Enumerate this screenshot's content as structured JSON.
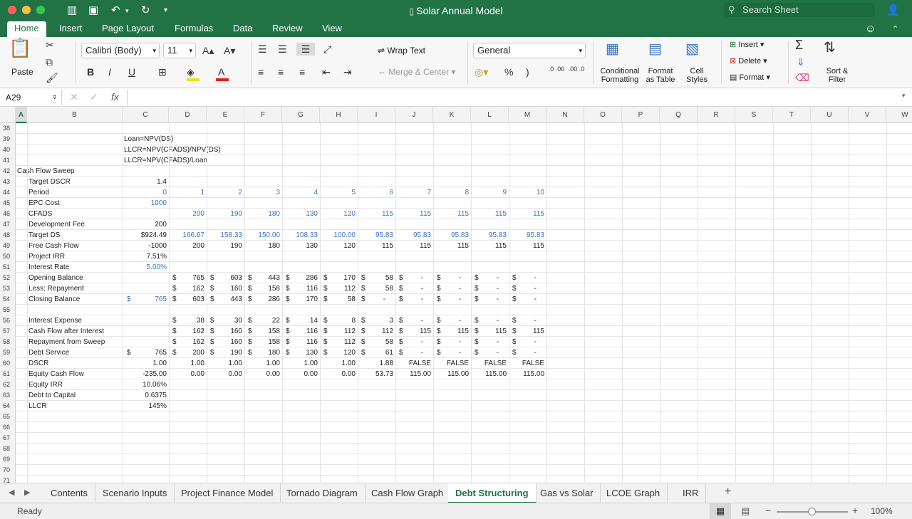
{
  "window": {
    "title": "Solar Annual Model",
    "search_placeholder": "Search Sheet"
  },
  "ribbon_tabs": [
    "Home",
    "Insert",
    "Page Layout",
    "Formulas",
    "Data",
    "Review",
    "View"
  ],
  "ribbon": {
    "paste": "Paste",
    "font_name": "Calibri (Body)",
    "font_size": "11",
    "wrap_text": "Wrap Text",
    "merge_center": "Merge & Center",
    "number_format": "General",
    "percent": "%",
    "comma": ")",
    "dec_inc": ".0 .00",
    "dec_dec": ".00 .0",
    "conditional": "Conditional",
    "formatting": "Formatting",
    "format": "Format",
    "as_table": "as Table",
    "cell": "Cell",
    "styles": "Styles",
    "insert": "Insert",
    "delete": "Delete",
    "format_menu": "Format",
    "sort": "Sort &",
    "filter": "Filter",
    "bold": "B",
    "italic": "I",
    "underline": "U",
    "font_a": "A"
  },
  "formula_bar": {
    "cell_ref": "A29",
    "fx": "fx",
    "value": ""
  },
  "columns": [
    "A",
    "B",
    "C",
    "D",
    "E",
    "F",
    "G",
    "H",
    "I",
    "J",
    "K",
    "L",
    "M",
    "N",
    "O",
    "P",
    "Q",
    "R",
    "S",
    "T",
    "U",
    "V",
    "W"
  ],
  "rows": [
    {
      "n": "38",
      "label": "",
      "sub": false,
      "c": "",
      "cb": false,
      "cells": [],
      "dollar": false
    },
    {
      "n": "39",
      "label": "",
      "sub": false,
      "c": "Loan=NPV(DS)",
      "cl": true,
      "cells": [],
      "dollar": false
    },
    {
      "n": "40",
      "label": "",
      "sub": false,
      "c": "LLCR=NPV(CFADS)/NPV(DS)",
      "cl": true,
      "cells": [],
      "dollar": false
    },
    {
      "n": "41",
      "label": "",
      "sub": false,
      "c": "LLCR=NPV(CFADS)/Loan",
      "cl": true,
      "cells": [],
      "dollar": false
    },
    {
      "n": "42",
      "label": "Cash Flow Sweep",
      "sub": false,
      "c": "",
      "cells": [],
      "dollar": false
    },
    {
      "n": "43",
      "label": "Target DSCR",
      "sub": true,
      "c": "1.4",
      "cells": [],
      "dollar": false
    },
    {
      "n": "44",
      "label": "Period",
      "sub": true,
      "c": "0",
      "cb": true,
      "cells": [
        "1",
        "2",
        "3",
        "4",
        "5",
        "6",
        "7",
        "8",
        "9",
        "10"
      ],
      "blue": true,
      "dollar": false
    },
    {
      "n": "45",
      "label": "EPC Cost",
      "sub": true,
      "c": "1000",
      "cb": true,
      "cells": [],
      "dollar": false
    },
    {
      "n": "46",
      "label": "CFADS",
      "sub": true,
      "c": "",
      "cells": [
        "200",
        "190",
        "180",
        "130",
        "120",
        "115",
        "115",
        "115",
        "115",
        "115"
      ],
      "blue": true,
      "dollar": false
    },
    {
      "n": "47",
      "label": "Development Fee",
      "sub": true,
      "c": "200",
      "cells": [],
      "dollar": false
    },
    {
      "n": "48",
      "label": "Target DS",
      "sub": true,
      "c": "$924.49",
      "cells": [
        "166.67",
        "158.33",
        "150.00",
        "108.33",
        "100.00",
        "95.83",
        "95.83",
        "95.83",
        "95.83",
        "95.83"
      ],
      "blue": true,
      "dollar": false
    },
    {
      "n": "49",
      "label": "Free Cash Flow",
      "sub": true,
      "c": "-1000",
      "cells": [
        "200",
        "190",
        "180",
        "130",
        "120",
        "115",
        "115",
        "115",
        "115",
        "115"
      ],
      "dollar": false
    },
    {
      "n": "50",
      "label": "Project IRR",
      "sub": true,
      "c": "7.51%",
      "cells": [],
      "dollar": false
    },
    {
      "n": "51",
      "label": "Interest Rate",
      "sub": true,
      "c": "5.00%",
      "cb": true,
      "cells": [],
      "dollar": false
    },
    {
      "n": "52",
      "label": "Opening Balance",
      "sub": true,
      "c": "",
      "cells": [
        "765",
        "603",
        "443",
        "286",
        "170",
        "58",
        "-",
        "-",
        "-",
        "-"
      ],
      "dollar": true
    },
    {
      "n": "53",
      "label": "Less: Repayment",
      "sub": true,
      "c": "",
      "cells": [
        "162",
        "160",
        "158",
        "116",
        "112",
        "58",
        "-",
        "-",
        "-",
        "-"
      ],
      "dollar": true
    },
    {
      "n": "54",
      "label": "Closing Balance",
      "sub": true,
      "c": "765",
      "cb": true,
      "cdollar": true,
      "cells": [
        "603",
        "443",
        "286",
        "170",
        "58",
        "-",
        "-",
        "-",
        "-",
        "-"
      ],
      "dollar": true
    },
    {
      "n": "55",
      "label": "",
      "sub": false,
      "c": "",
      "cells": [],
      "dollar": false
    },
    {
      "n": "56",
      "label": "Interest Expense",
      "sub": true,
      "c": "",
      "cells": [
        "38",
        "30",
        "22",
        "14",
        "8",
        "3",
        "-",
        "-",
        "-",
        "-"
      ],
      "dollar": true
    },
    {
      "n": "57",
      "label": "Cash Flow after Interest",
      "sub": true,
      "c": "",
      "cells": [
        "162",
        "160",
        "158",
        "116",
        "112",
        "112",
        "115",
        "115",
        "115",
        "115"
      ],
      "dollar": true
    },
    {
      "n": "58",
      "label": "Repayment from Sweep",
      "sub": true,
      "c": "",
      "cells": [
        "162",
        "160",
        "158",
        "116",
        "112",
        "58",
        "-",
        "-",
        "-",
        "-"
      ],
      "dollar": true
    },
    {
      "n": "59",
      "label": "Debt Service",
      "sub": true,
      "c": "765",
      "cdollar": true,
      "cells": [
        "200",
        "190",
        "180",
        "130",
        "120",
        "61",
        "-",
        "-",
        "-",
        "-"
      ],
      "dollar": true
    },
    {
      "n": "60",
      "label": "DSCR",
      "sub": true,
      "c": "1.00",
      "cells": [
        "1.00",
        "1.00",
        "1.00",
        "1.00",
        "1.00",
        "1.88",
        "FALSE",
        "FALSE",
        "FALSE",
        "FALSE"
      ],
      "dollar": false
    },
    {
      "n": "61",
      "label": "Equity Cash Flow",
      "sub": true,
      "c": "-235.00",
      "cells": [
        "0.00",
        "0.00",
        "0.00",
        "0.00",
        "0.00",
        "53.73",
        "115.00",
        "115.00",
        "115.00",
        "115.00"
      ],
      "dollar": false
    },
    {
      "n": "62",
      "label": "Equity IRR",
      "sub": true,
      "c": "10.06%",
      "cells": [],
      "dollar": false
    },
    {
      "n": "63",
      "label": "Debt to Capital",
      "sub": true,
      "c": "0.6375",
      "cells": [],
      "dollar": false
    },
    {
      "n": "64",
      "label": "LLCR",
      "sub": true,
      "c": "145%",
      "cells": [],
      "dollar": false
    },
    {
      "n": "65",
      "label": "",
      "sub": false,
      "c": "",
      "cells": [],
      "dollar": false
    },
    {
      "n": "66",
      "label": "",
      "sub": false,
      "c": "",
      "cells": [],
      "dollar": false
    },
    {
      "n": "67",
      "label": "",
      "sub": false,
      "c": "",
      "cells": [],
      "dollar": false
    },
    {
      "n": "68",
      "label": "",
      "sub": false,
      "c": "",
      "cells": [],
      "dollar": false
    },
    {
      "n": "69",
      "label": "",
      "sub": false,
      "c": "",
      "cells": [],
      "dollar": false
    },
    {
      "n": "70",
      "label": "",
      "sub": false,
      "c": "",
      "cells": [],
      "dollar": false
    },
    {
      "n": "71",
      "label": "",
      "sub": false,
      "c": "",
      "cells": [],
      "dollar": false
    }
  ],
  "currency_symbol": "$",
  "sheet_tabs": [
    "Contents",
    "Scenario Inputs",
    "Project Finance Model",
    "Tornado Diagram",
    "Cash Flow Graph",
    "Debt Structuring",
    "Gas vs Solar",
    "LCOE Graph",
    "IRR"
  ],
  "active_sheet": "Debt Structuring",
  "status": {
    "ready": "Ready",
    "zoom": "100%"
  },
  "colors": {
    "accent": "#217346",
    "blue_text": "#3a73c5"
  }
}
